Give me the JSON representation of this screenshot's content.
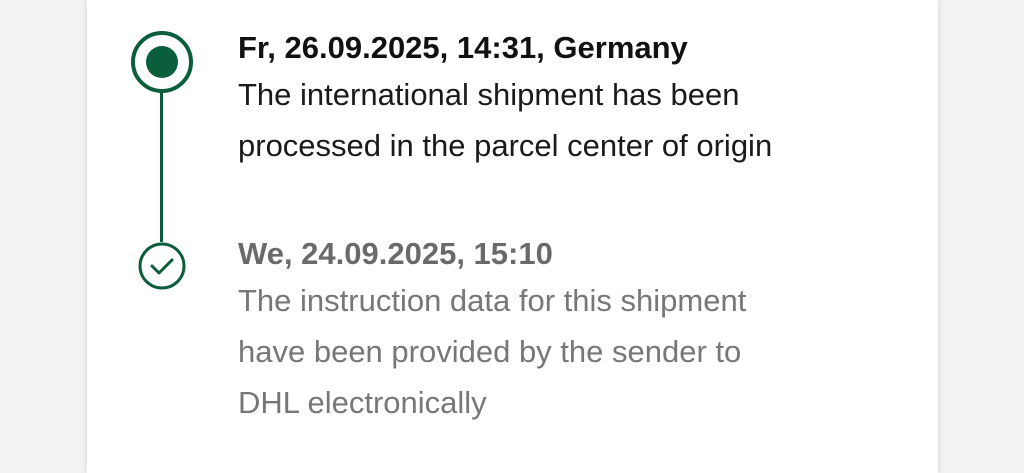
{
  "colors": {
    "accent": "#0b5e3b",
    "background": "#f2f2f2",
    "card": "#ffffff"
  },
  "events": [
    {
      "status": "current",
      "icon": "filled-dot-icon",
      "title": "Fr, 26.09.2025, 14:31, Germany",
      "description_lines": [
        "The international shipment has been",
        "processed in the parcel center of origin"
      ]
    },
    {
      "status": "completed",
      "icon": "check-circle-icon",
      "title": "We, 24.09.2025, 15:10",
      "description_lines": [
        "The instruction data for this shipment",
        "have been provided by the sender to",
        "DHL electronically"
      ]
    }
  ]
}
